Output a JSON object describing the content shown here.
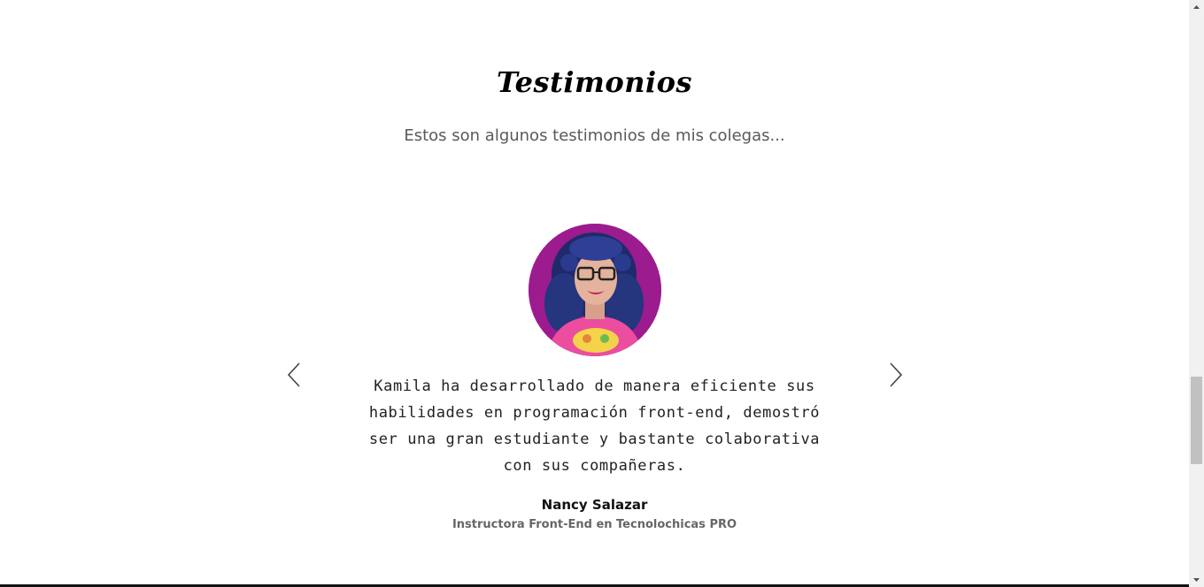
{
  "section": {
    "title": "Testimonios",
    "subtitle": "Estos son algunos testimonios de mis colegas..."
  },
  "testimonial": {
    "quote": "Kamila ha desarrollado de manera eficiente sus habilidades en programación front-end, demostró ser una gran estudiante y bastante colaborativa con sus compañeras.",
    "author": "Nancy Salazar",
    "role": "Instructora Front-End en Tecnolochicas PRO",
    "avatar_background": "#9c1b8f"
  },
  "carousel": {
    "prev_icon": "chevron-left-icon",
    "next_icon": "chevron-right-icon"
  },
  "colors": {
    "title": "#000000",
    "subtitle": "#595959",
    "role": "#666666",
    "avatar_bg": "#9c1b8f"
  }
}
